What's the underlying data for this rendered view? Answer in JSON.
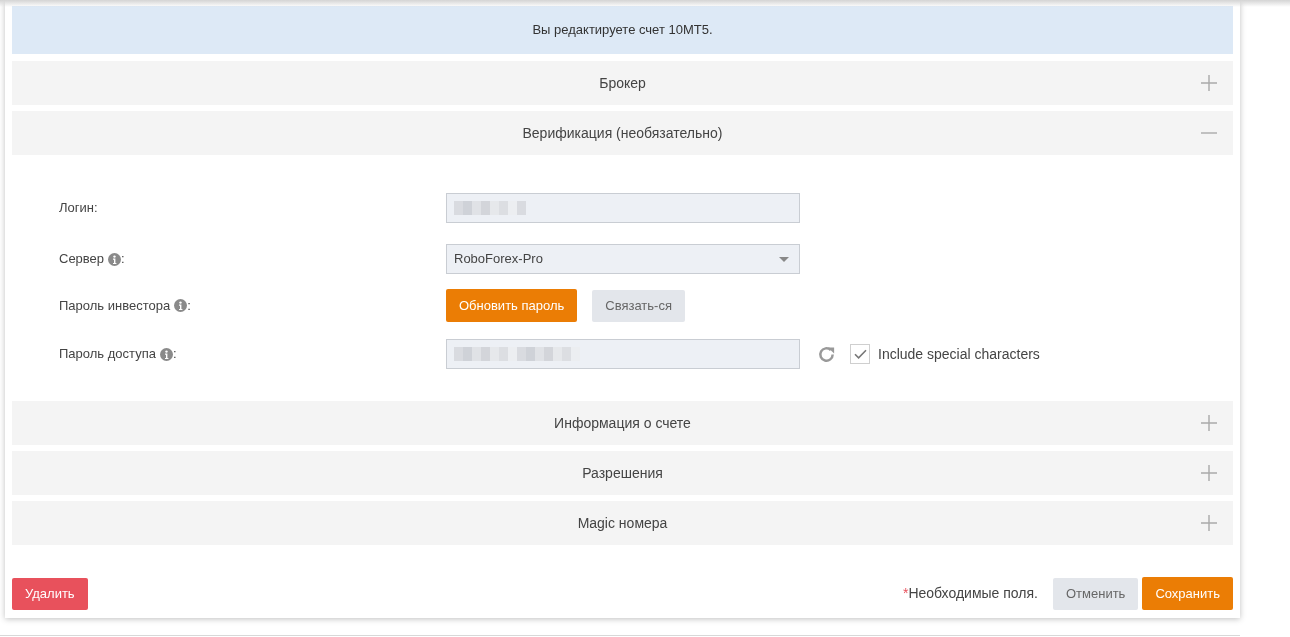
{
  "banner": {
    "text": "Вы редактируете счет 10MT5."
  },
  "sections": [
    {
      "title": "Брокер",
      "expanded": false
    },
    {
      "title": "Верификация (необязательно)",
      "expanded": true,
      "fields": [
        {
          "kind": "text",
          "label": "Логин",
          "label_end": ":",
          "info": false,
          "redacted": true
        },
        {
          "kind": "select",
          "label": "Сервер",
          "label_end": ":",
          "info": true,
          "value": "RoboForex-Pro"
        },
        {
          "kind": "buttons",
          "label": "Пароль инвестора",
          "label_end": ":",
          "info": true,
          "buttons": [
            {
              "label": "Обновить пароль",
              "kind": "primary"
            },
            {
              "label": "Связать-ся",
              "kind": "secondary"
            }
          ]
        },
        {
          "kind": "password",
          "label": "Пароль доступа",
          "label_end": ":",
          "info": true,
          "redacted": true,
          "option": {
            "label": "Include special characters",
            "checked": true
          }
        }
      ]
    },
    {
      "title": "Информация о счете",
      "expanded": false
    },
    {
      "title": "Разрешения",
      "expanded": false
    },
    {
      "title": "Magic номера",
      "expanded": false
    }
  ],
  "footer": {
    "delete": {
      "label": "Удалить",
      "kind": "danger"
    },
    "required_mark": "*",
    "required_text": "Необходимые поля.",
    "buttons": [
      {
        "label": "Отменить",
        "kind": "secondary"
      },
      {
        "label": "Сохранить",
        "kind": "primary"
      }
    ]
  }
}
